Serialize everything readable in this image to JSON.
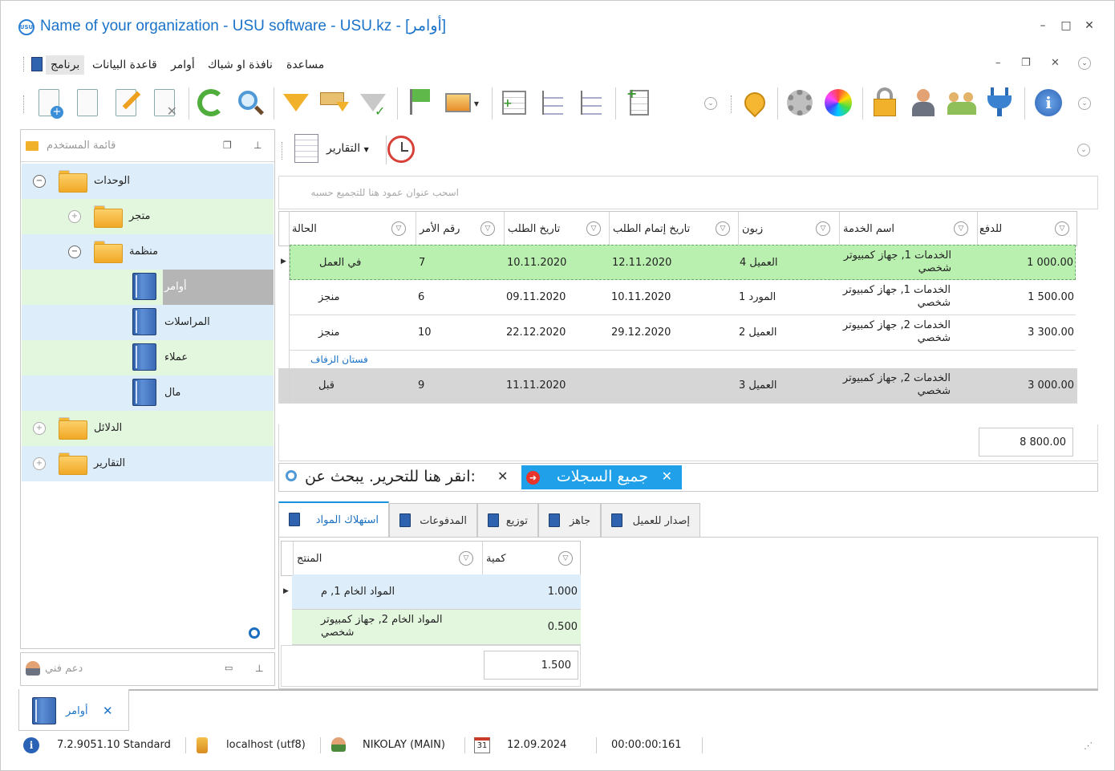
{
  "window": {
    "logo_text": "USU",
    "title": "Name of your organization - USU software - USU.kz - [أوامر]",
    "min": "–",
    "max": "□",
    "close": "✕"
  },
  "menu": {
    "items": [
      "برنامج",
      "قاعدة البيانات",
      "أوامر",
      "نافذة او شباك",
      "مساعدة"
    ]
  },
  "left_panel": {
    "title": "قائمة المستخدم",
    "tree": {
      "units": "الوحدات",
      "shop": "متجر",
      "organization": "منظمة",
      "orders": "أوامر",
      "correspondence": "المراسلات",
      "clients": "عملاء",
      "money": "مال",
      "directories": "الدلائل",
      "reports": "التقارير"
    }
  },
  "support_panel": {
    "title": "دعم فني"
  },
  "reports_bar": {
    "label": "التقارير"
  },
  "group_hint": "اسحب عنوان عمود هنا للتجميع حسبه",
  "grid": {
    "columns": {
      "status": "الحالة",
      "order_no": "رقم الأمر",
      "request_date": "تاريخ الطلب",
      "completion_date": "تاريخ إتمام الطلب",
      "customer": "زبون",
      "service": "اسم الخدمة",
      "payment": "للدفع"
    },
    "rows": [
      {
        "status": "في العمل",
        "order_no": "7",
        "request_date": "10.11.2020",
        "completion_date": "12.11.2020",
        "customer": "العميل 4",
        "service": "الخدمات 1, جهاز كمبيوتر شخصي",
        "payment": "1 000.00"
      },
      {
        "status": "منجز",
        "order_no": "6",
        "request_date": "09.11.2020",
        "completion_date": "10.11.2020",
        "customer": "المورد 1",
        "service": "الخدمات 1, جهاز كمبيوتر شخصي",
        "payment": "1 500.00"
      },
      {
        "status": "منجز",
        "order_no": "10",
        "request_date": "22.12.2020",
        "completion_date": "29.12.2020",
        "customer": "العميل 2",
        "service": "الخدمات 2, جهاز كمبيوتر شخصي",
        "payment": "3 300.00"
      },
      {
        "status": "قبل",
        "order_no": "9",
        "request_date": "11.11.2020",
        "completion_date": "",
        "customer": "العميل 3",
        "service": "الخدمات 2, جهاز كمبيوتر شخصي",
        "payment": "3 000.00"
      }
    ],
    "link_text": "فستان الزفاف",
    "total": "8 800.00"
  },
  "filter_bar": {
    "chip_label": "جميع السجلات",
    "chip_close": "✕",
    "hint": "انقر هنا للتحرير. يبحث عن:",
    "hint_close": "✕"
  },
  "tabs": {
    "items": [
      "استهلاك المواد",
      "المدفوعات",
      "توزيع",
      "جاهز",
      "إصدار للعميل"
    ]
  },
  "sub_grid": {
    "columns": {
      "product": "المنتج",
      "quantity": "كمية"
    },
    "rows": [
      {
        "product": "المواد الخام 1, م",
        "quantity": "1.000"
      },
      {
        "product": "المواد الخام 2, جهاز كمبيوتر شخصي",
        "quantity": "0.500"
      }
    ],
    "total": "1.500"
  },
  "doc_tab": {
    "label": "أوامر",
    "close": "✕"
  },
  "status": {
    "version": "7.2.9051.10 Standard",
    "db": "localhost (utf8)",
    "user": "NIKOLAY (MAIN)",
    "calendar_day": "31",
    "date": "12.09.2024",
    "timer": "00:00:00:161"
  },
  "colors": {
    "accent": "#1a73c9",
    "selected_row": "#b9f0b0",
    "tree_blue": "#ddeefa",
    "tree_green": "#e3f6de",
    "chip": "#1fa0e8"
  }
}
